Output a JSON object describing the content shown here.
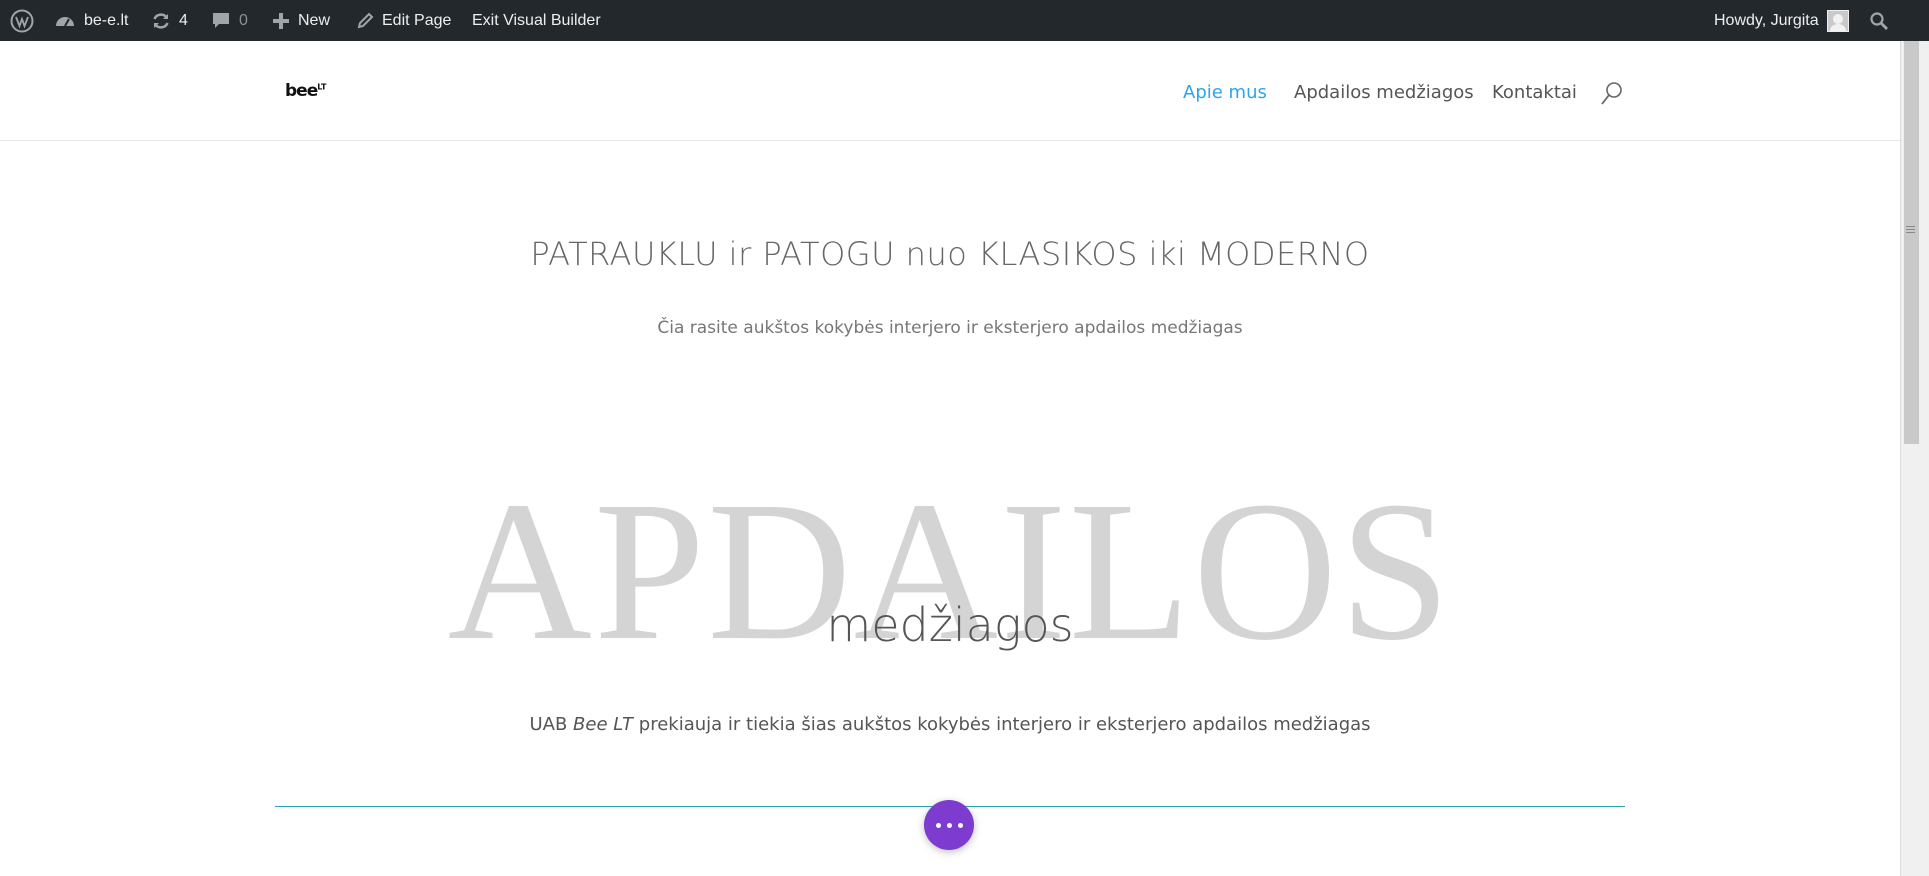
{
  "admin_bar": {
    "site_name": "be-e.lt",
    "updates_count": "4",
    "comments_count": "0",
    "new_label": "New",
    "edit_page_label": "Edit Page",
    "exit_builder_label": "Exit Visual Builder",
    "greeting": "Howdy, Jurgita"
  },
  "header": {
    "logo_text": "bee",
    "logo_sup": "LT",
    "nav": [
      {
        "label": "Apie mus",
        "active": true
      },
      {
        "label": "Apdailos medžiagos",
        "active": false
      },
      {
        "label": "Kontaktai",
        "active": false
      }
    ]
  },
  "hero": {
    "headline": "PATRAUKLU ir PATOGU nuo KLASIKOS iki MODERNO",
    "subline": "Čia rasite aukštos kokybės interjero ir eksterjero apdailos medžiagas"
  },
  "section": {
    "big_word": "APDAILOS",
    "overlay_word": "medžiagos",
    "body_prefix": "UAB ",
    "body_em": "Bee LT",
    "body_suffix": " prekiauja ir tiekia šias aukštos kokybės interjero ir eksterjero apdailos medžiagas"
  },
  "colors": {
    "admin_bar_bg": "#23282d",
    "accent": "#2ea3f2",
    "fab": "#7e3bd0"
  }
}
